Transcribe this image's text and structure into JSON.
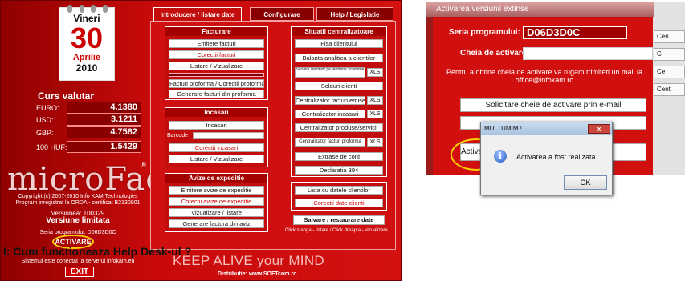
{
  "calendar": {
    "weekday": "Vineri",
    "day": "30",
    "month": "Aprilie",
    "year": "2010"
  },
  "tabs": [
    "Introducere / listare date",
    "Configurare",
    "Help / Legislatie"
  ],
  "curs": {
    "title": "Curs valutar",
    "rows": [
      {
        "label": "EURO:",
        "value": "4.1380"
      },
      {
        "label": "USD:",
        "value": "3.1211"
      },
      {
        "label": "GBP:",
        "value": "4.7582"
      },
      {
        "label": "100 HUF:",
        "value": "1.5429"
      }
    ]
  },
  "logo": "microFact",
  "registered": "®",
  "copyright": "Copyright (c) 2007-2010 Info KAM Technologies",
  "program_reg": "Program inregistrat la ORDA - certificat B2130901",
  "version": "Versiunea: 100329",
  "version_type": "Versiune limitata",
  "serial_line": "Seria programului: D06D3D0C",
  "activate_label": "ACTIVARE",
  "server_status": "Sistemul este conectat la serverul infokam.eu",
  "exit_label": "EXIT",
  "help_question": "I: Cum functioneaza Help Desk-ul ?",
  "slogan": "KEEP ALIVE your MIND",
  "distributor": "Distributie: www.SOFTcom.ro",
  "facturare": {
    "title": "Facturare",
    "items": [
      "Emitere facturi",
      "Corectii facturi",
      "Listare / Vizualizare",
      "Facturi proforma / Corectii proforma",
      "Generare facturi din proforma"
    ]
  },
  "incasari": {
    "title": "Incasari",
    "items": [
      "Incasari",
      "Corectii incasari",
      "Listare / Vizualizare"
    ],
    "barcode_label": "Barcode"
  },
  "avize": {
    "title": "Avize de expeditie",
    "items": [
      "Emitere avize de expeditie",
      "Corectii avize de expeditie",
      "Vizualizare / listare",
      "Generare factura din aviz"
    ]
  },
  "situatii": {
    "title": "Situatii centralizatoare",
    "items": [
      "Fisa clientului",
      "Balanta analitica a clientilor",
      "Situatia clientilor pe termene scadente",
      "Solduri clienti",
      "Centralizator facturi emise",
      "Centralizator incasari",
      "Centralizator produse/servicii",
      "Centralizator facturi proforma",
      "Extrase de cont",
      "Declaratia 394"
    ],
    "xls": "XLS"
  },
  "clients": {
    "items": [
      "Lista cu datele clientilor",
      "Corectii date clienti"
    ]
  },
  "backup": "Salvare / restaurare date",
  "click_hint": "Click stanga - listare / Click dreapta - vizualizare",
  "dialog": {
    "title": "Activarea versiunii extinse",
    "serial_label": "Seria programului:",
    "serial_value": "D06D3D0C",
    "key_label": "Cheia de activare:",
    "info": "Pentru a obtine cheia de activare va rugam trimiteti un mail la office@infokam.ro",
    "request_btn": "Solicitare cheie de activare prin e-mail",
    "activate_partial": "Activa",
    "side_tabs": [
      "Cen",
      "C",
      "Ce",
      "Cent"
    ],
    "left_digits": [
      "138",
      "21",
      "758",
      "542"
    ],
    "msgbox": {
      "title": "MULTUMIM !",
      "message": "Activarea a fost realizata",
      "ok": "OK",
      "close": "x"
    }
  }
}
